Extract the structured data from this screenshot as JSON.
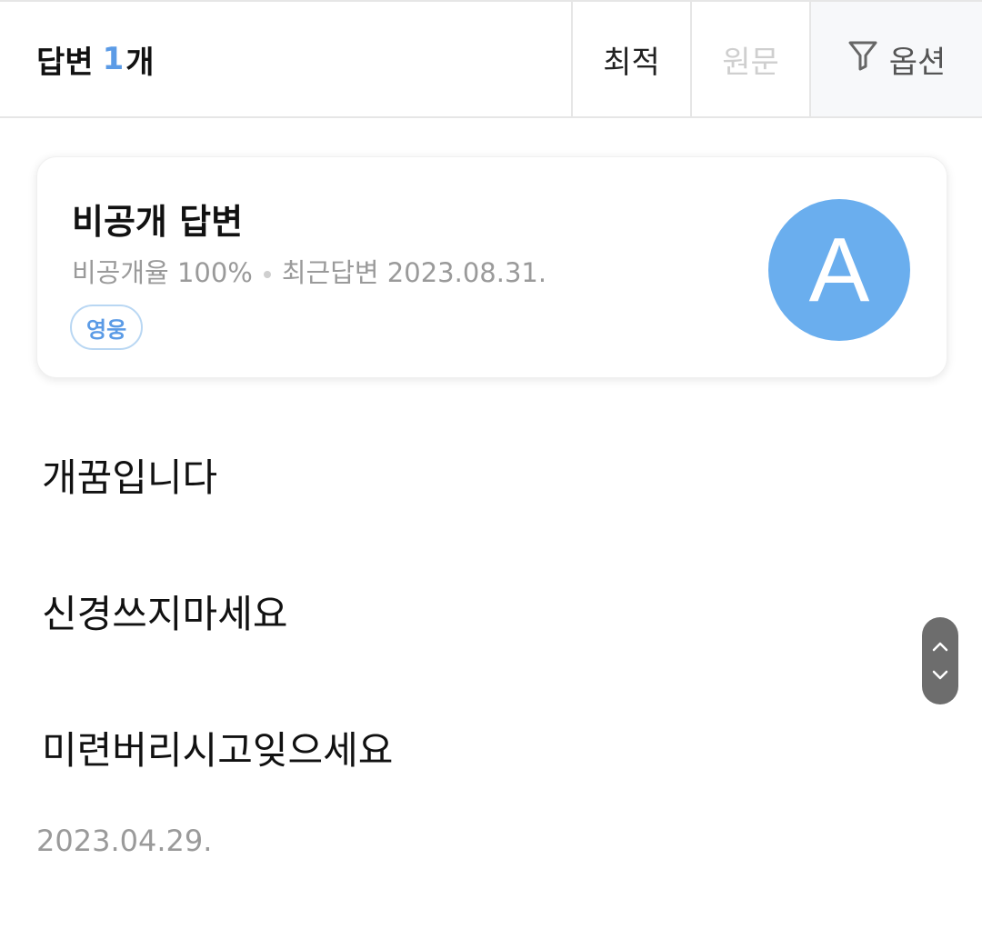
{
  "header": {
    "title_prefix": "답변",
    "count": "1",
    "title_suffix": "개",
    "sort_options": [
      {
        "label": "최적",
        "active": true
      },
      {
        "label": "원문",
        "active": false
      }
    ],
    "option_label": "옵션",
    "option_icon": "filter-icon"
  },
  "card": {
    "title": "비공개 답변",
    "private_rate": "비공개율 100%",
    "recent_answer": "최근답변 2023.08.31.",
    "badge": "영웅",
    "avatar_letter": "A",
    "avatar_color": "#6aaeee"
  },
  "answer": {
    "lines": [
      "개꿈입니다",
      "신경쓰지마세요",
      "미련버리시고잊으세요"
    ],
    "date": "2023.04.29."
  },
  "scroll": {
    "up_icon": "chevron-up-icon",
    "down_icon": "chevron-down-icon"
  },
  "colors": {
    "accent": "#5b9be6",
    "muted_text": "#9a9a9a"
  }
}
